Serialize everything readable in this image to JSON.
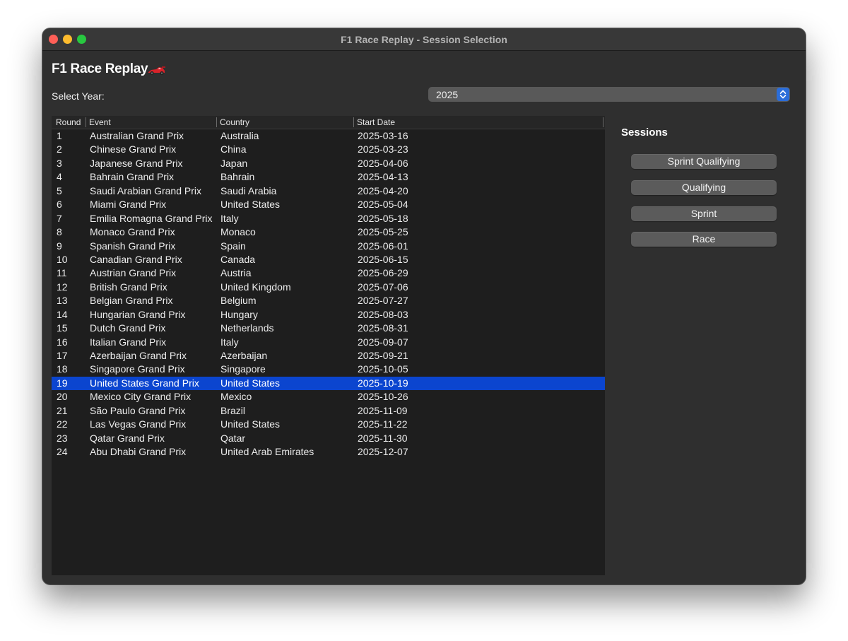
{
  "window": {
    "title": "F1 Race Replay - Session Selection"
  },
  "app": {
    "title": "F1 Race Replay",
    "icon": "race-car-icon"
  },
  "year": {
    "label": "Select Year:",
    "value": "2025"
  },
  "table": {
    "columns": [
      "Round",
      "Event",
      "Country",
      "Start Date"
    ],
    "selected_round": "19",
    "rows": [
      [
        "1",
        "Australian Grand Prix",
        "Australia",
        "2025-03-16"
      ],
      [
        "2",
        "Chinese Grand Prix",
        "China",
        "2025-03-23"
      ],
      [
        "3",
        "Japanese Grand Prix",
        "Japan",
        "2025-04-06"
      ],
      [
        "4",
        "Bahrain Grand Prix",
        "Bahrain",
        "2025-04-13"
      ],
      [
        "5",
        "Saudi Arabian Grand Prix",
        "Saudi Arabia",
        "2025-04-20"
      ],
      [
        "6",
        "Miami Grand Prix",
        "United States",
        "2025-05-04"
      ],
      [
        "7",
        "Emilia Romagna Grand Prix",
        "Italy",
        "2025-05-18"
      ],
      [
        "8",
        "Monaco Grand Prix",
        "Monaco",
        "2025-05-25"
      ],
      [
        "9",
        "Spanish Grand Prix",
        "Spain",
        "2025-06-01"
      ],
      [
        "10",
        "Canadian Grand Prix",
        "Canada",
        "2025-06-15"
      ],
      [
        "11",
        "Austrian Grand Prix",
        "Austria",
        "2025-06-29"
      ],
      [
        "12",
        "British Grand Prix",
        "United Kingdom",
        "2025-07-06"
      ],
      [
        "13",
        "Belgian Grand Prix",
        "Belgium",
        "2025-07-27"
      ],
      [
        "14",
        "Hungarian Grand Prix",
        "Hungary",
        "2025-08-03"
      ],
      [
        "15",
        "Dutch Grand Prix",
        "Netherlands",
        "2025-08-31"
      ],
      [
        "16",
        "Italian Grand Prix",
        "Italy",
        "2025-09-07"
      ],
      [
        "17",
        "Azerbaijan Grand Prix",
        "Azerbaijan",
        "2025-09-21"
      ],
      [
        "18",
        "Singapore Grand Prix",
        "Singapore",
        "2025-10-05"
      ],
      [
        "19",
        "United States Grand Prix",
        "United States",
        "2025-10-19"
      ],
      [
        "20",
        "Mexico City Grand Prix",
        "Mexico",
        "2025-10-26"
      ],
      [
        "21",
        "São Paulo Grand Prix",
        "Brazil",
        "2025-11-09"
      ],
      [
        "22",
        "Las Vegas Grand Prix",
        "United States",
        "2025-11-22"
      ],
      [
        "23",
        "Qatar Grand Prix",
        "Qatar",
        "2025-11-30"
      ],
      [
        "24",
        "Abu Dhabi Grand Prix",
        "United Arab Emirates",
        "2025-12-07"
      ]
    ]
  },
  "sessions": {
    "label": "Sessions",
    "buttons": [
      "Sprint Qualifying",
      "Qualifying",
      "Sprint",
      "Race"
    ]
  },
  "colors": {
    "window_bg": "#2f2f2f",
    "table_bg": "#1e1e1e",
    "selection": "#0b45cf",
    "button_bg": "#5b5b5b",
    "accent": "#2b6dd9"
  }
}
